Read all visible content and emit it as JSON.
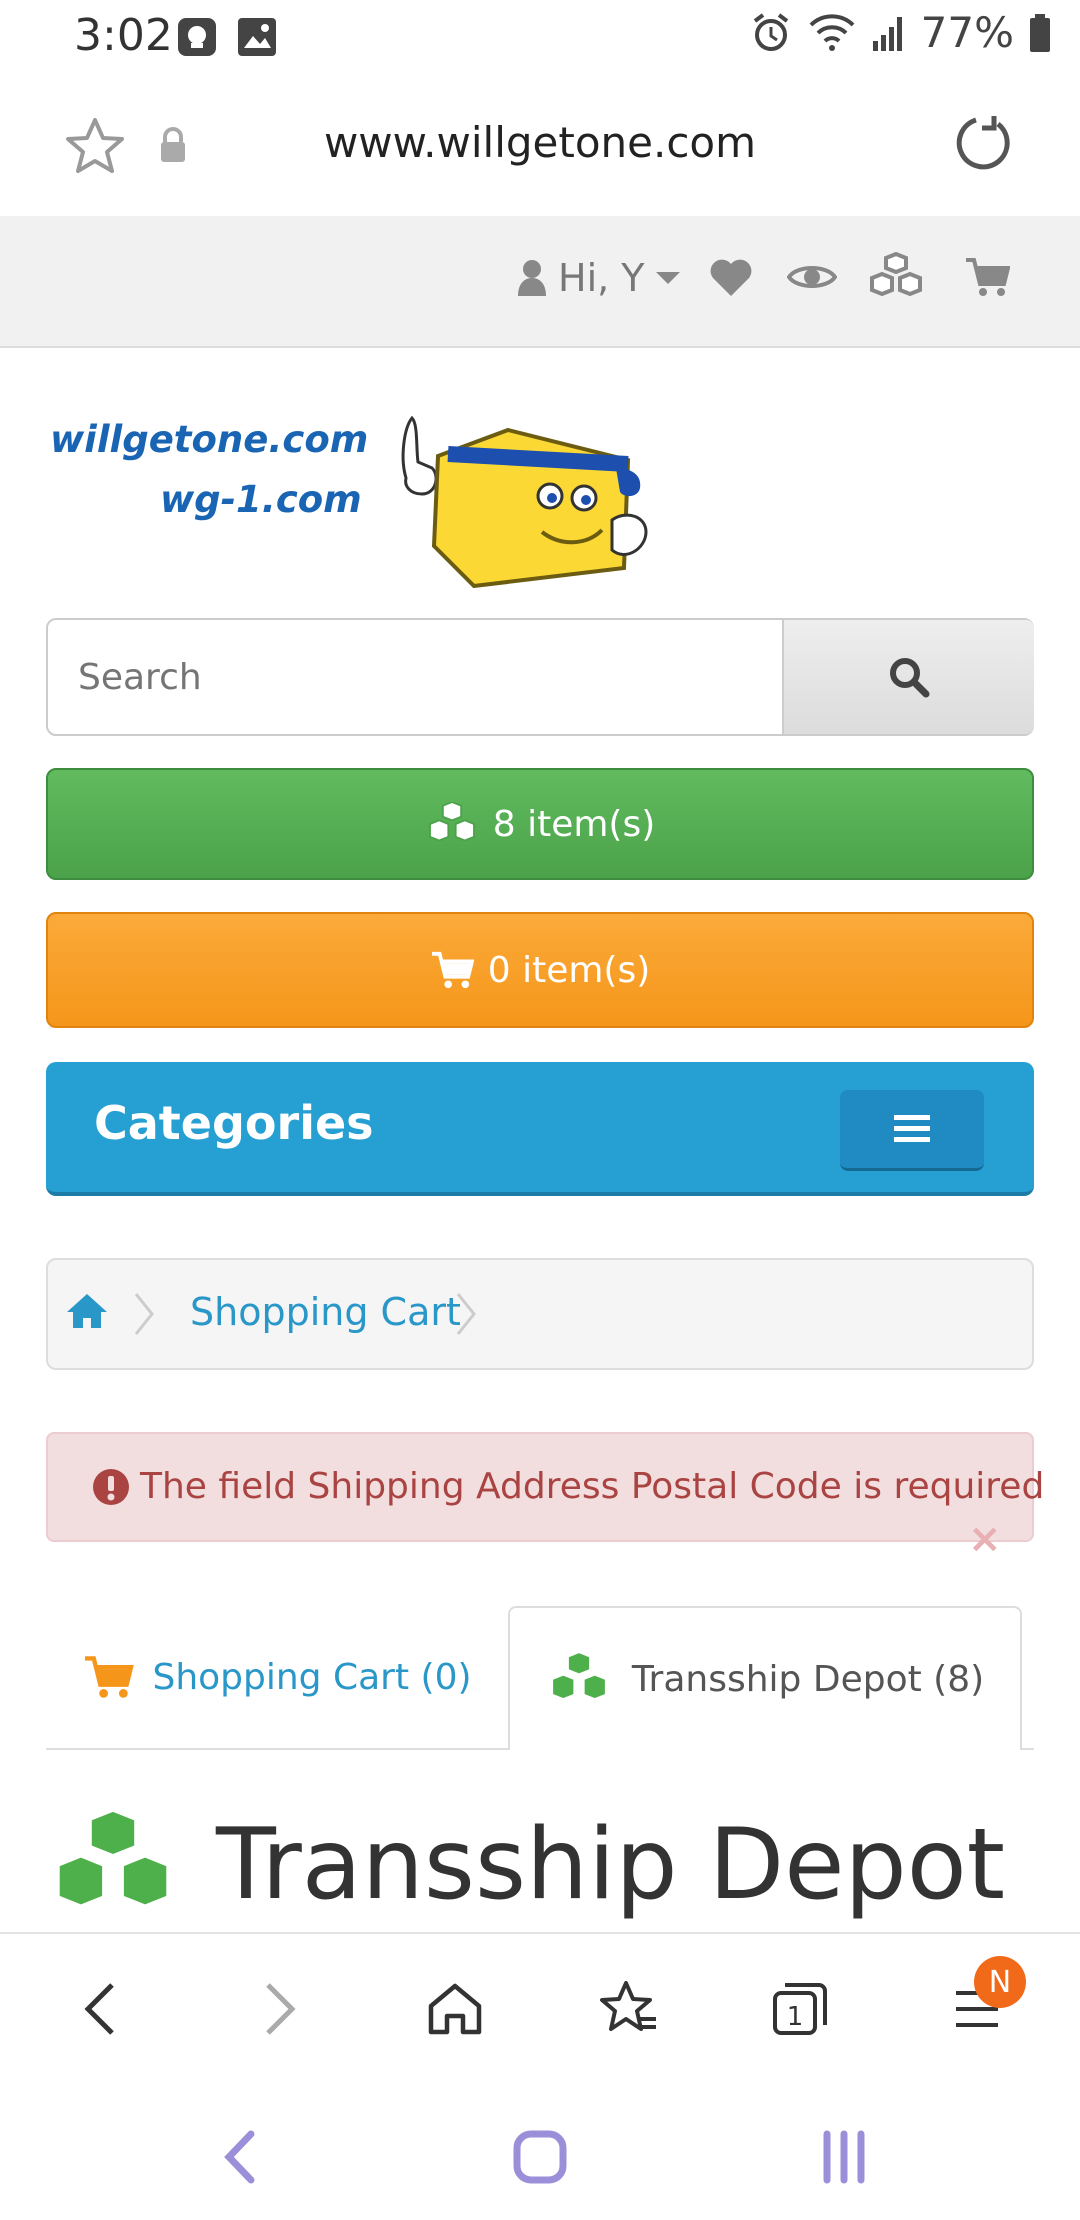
{
  "status": {
    "time": "3:02",
    "battery": "77%"
  },
  "browser": {
    "url": "www.willgetone.com"
  },
  "topnav": {
    "greeting": "Hi, Y"
  },
  "logo": {
    "line1": "willgetone.com",
    "line2": "wg-1.com"
  },
  "search": {
    "placeholder": "Search"
  },
  "depot_button": {
    "label": "8 item(s)"
  },
  "cart_button": {
    "label": "0 item(s)"
  },
  "categories": {
    "title": "Categories"
  },
  "breadcrumb": {
    "current": "Shopping Cart"
  },
  "alert": {
    "message": "The field Shipping Address Postal Code is required",
    "close": "×"
  },
  "tabs": [
    {
      "label": "Shopping Cart (0)"
    },
    {
      "label": "Transship Depot (8)"
    }
  ],
  "heading": {
    "title": "Transship Depot"
  },
  "bottombar": {
    "tab_count": "1",
    "badge": "N"
  },
  "colors": {
    "green": "#4ba24a",
    "orange": "#f5961a",
    "blue": "#269fd3",
    "link": "#2a97c9",
    "alert_text": "#a94442"
  }
}
